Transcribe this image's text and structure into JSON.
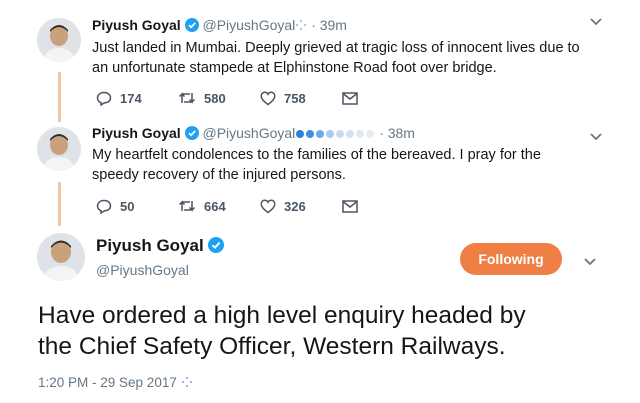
{
  "tweet1": {
    "name": "Piyush Goyal",
    "handle": "@PiyushGoyal",
    "time": "· 39m",
    "text_line1": "Just landed in Mumbai. Deeply grieved at tragic loss of innocent lives due to",
    "text_line2": "an unfortunate stampede at Elphinstone Road foot over bridge.",
    "replies": "174",
    "retweets": "580",
    "likes": "758"
  },
  "tweet2": {
    "name": "Piyush Goyal",
    "handle": "@PiyushGoyal",
    "time": "· 38m",
    "text_line1": "My heartfelt condolences to the families of the bereaved. I pray for the",
    "text_line2": "speedy recovery of the injured persons.",
    "replies": "50",
    "retweets": "664",
    "likes": "326"
  },
  "main_tweet": {
    "name": "Piyush Goyal",
    "handle": "@PiyushGoyal",
    "follow_label": "Following",
    "text_line1": "Have ordered a high level enquiry headed by",
    "text_line2": "the Chief Safety Officer, Western Railways.",
    "timestamp": "1:20 PM - 29 Sep 2017"
  },
  "colors": {
    "accent": "#ef7f45",
    "thread_line": "#f2c4a8",
    "verified": "#1da1f2"
  },
  "icons": [
    "reply-icon",
    "retweet-icon",
    "like-icon",
    "message-icon",
    "verified-icon",
    "caret-down-icon"
  ]
}
